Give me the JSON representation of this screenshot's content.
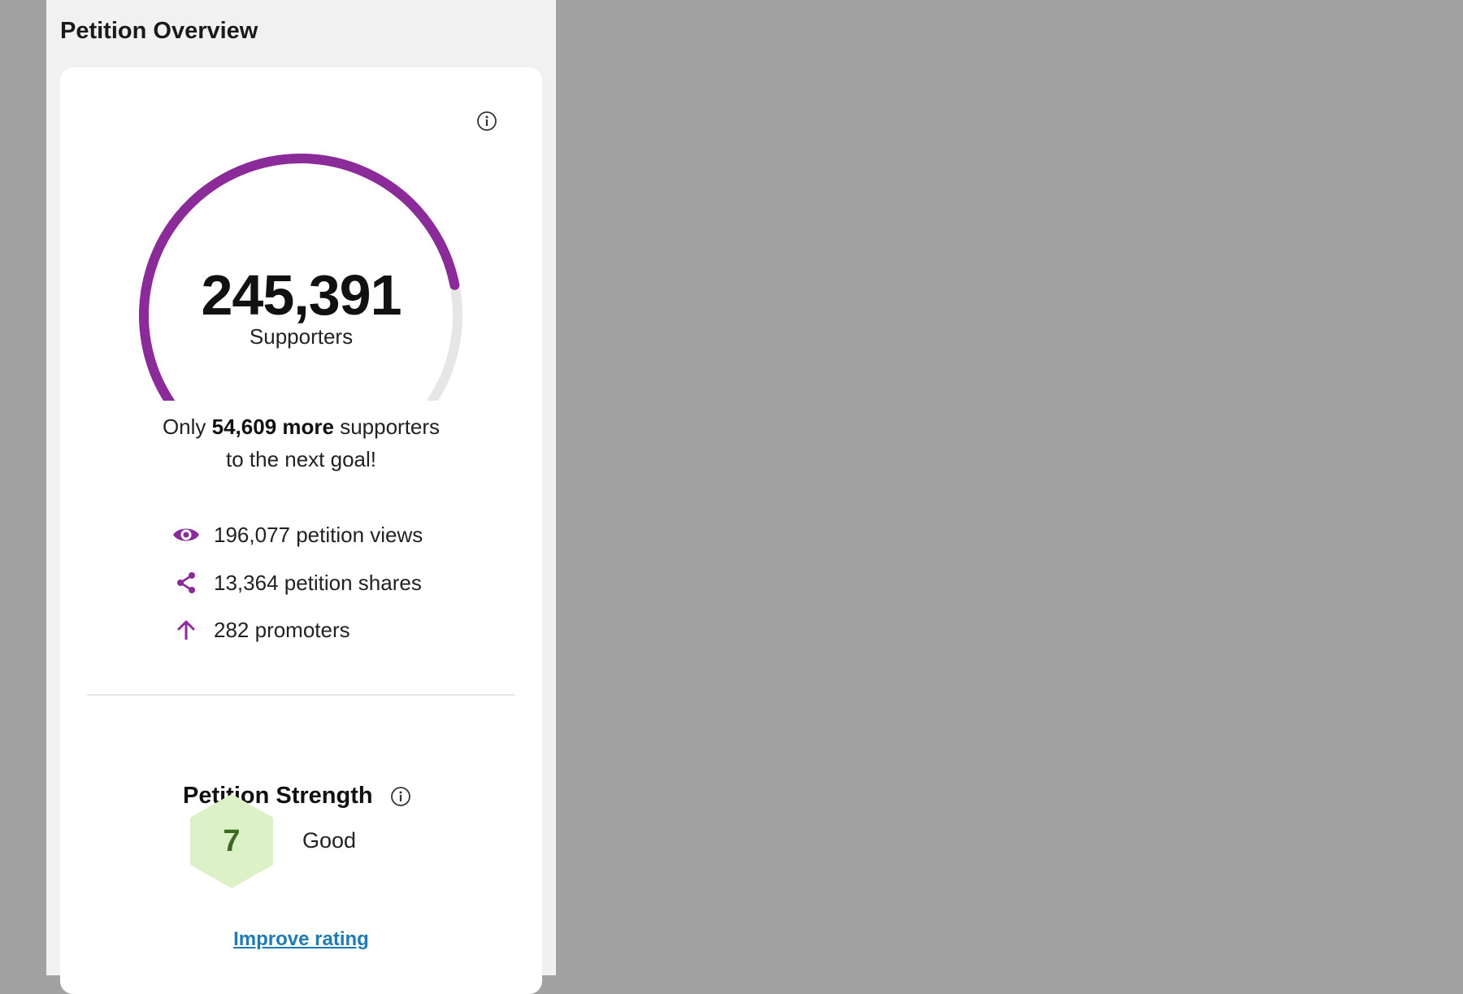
{
  "panel": {
    "title": "Petition Overview"
  },
  "icons": {
    "info": "info-icon",
    "views": "eye-icon",
    "shares": "share-icon",
    "promoters": "arrow-up-icon"
  },
  "colors": {
    "accent": "#8b2a99",
    "gauge_track": "#e6e6e6",
    "hex_fill": "#dcf2c6",
    "rating_text": "#3b6b22",
    "link": "#1f7bb6"
  },
  "supporters": {
    "count": "245,391",
    "label": "Supporters",
    "progress": 0.818
  },
  "goal": {
    "prefix": "Only ",
    "remaining": "54,609 more",
    "suffix": " supporters",
    "line2": "to the next goal!"
  },
  "stats": {
    "views": "196,077 petition views",
    "shares": "13,364 petition shares",
    "promoters": "282 promoters"
  },
  "strength": {
    "title": "Petition Strength",
    "score": "7",
    "rating": "Good",
    "improve_link": "Improve rating"
  }
}
